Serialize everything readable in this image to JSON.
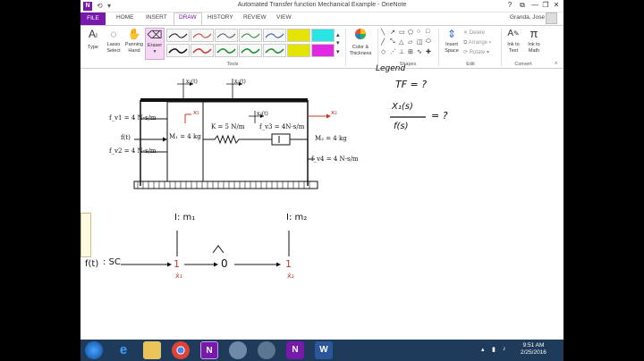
{
  "window": {
    "title": "Automated Transfer function Mechanical Example - OneNote",
    "logo": "N",
    "back_icon": "back-arrow-icon",
    "controls": [
      "?",
      "⧉",
      "—",
      "❐",
      "✕"
    ]
  },
  "tabs": [
    "FILE",
    "HOME",
    "INSERT",
    "DRAW",
    "HISTORY",
    "REVIEW",
    "VIEW"
  ],
  "active_tab": "DRAW",
  "user": {
    "name": "Granda, Jose"
  },
  "ribbon": {
    "type": "Type",
    "lasso": [
      "Lasso",
      "Select"
    ],
    "panning": [
      "Panning",
      "Hand"
    ],
    "eraser": "Eraser",
    "color": [
      "Color &",
      "Thickness"
    ],
    "insert_space": [
      "Insert",
      "Space"
    ],
    "delete": "Delete",
    "arrange": "Arrange",
    "rotate": "Rotate",
    "ink_text": [
      "Ink to",
      "Text"
    ],
    "ink_math": [
      "Ink to",
      "Math"
    ],
    "groups": {
      "tools": "Tools",
      "shapes": "Shapes",
      "edit": "Edit",
      "convert": "Convert"
    },
    "highlighter_colors": [
      "#e4e400",
      "#29e4e4",
      "#e029e0"
    ],
    "pen_colors": [
      "#111111",
      "#c0392b",
      "#1f4fb5",
      "#1a8a2a",
      "#555555"
    ]
  },
  "note": {
    "handwritten_header": "Legend",
    "tf_question": "TF = ?",
    "tf_fraction_num": "X₁(s)",
    "tf_fraction_den": "f(s)",
    "tf_equals": "= ?",
    "x1_label": "x₁(t)",
    "x2_label": "x₂(t)",
    "x1_arrow_label": "x₁",
    "x2_arrow_label": "x₂",
    "x3_label": "x₃(t)",
    "fv1": "f_v1 = 4 N-s/m",
    "f_label": "f(t)",
    "fv2": "f_v2 = 4 N-s/m",
    "m1": "M₁ = 4 kg",
    "k": "K = 5 N/m",
    "fv3": "f_v3 = 4N-s/m",
    "m2": "M₂ = 4 kg",
    "fv4": "f_v4 = 4 N-s/m",
    "node1_label": "I: m₁",
    "node2_label": "I: m₂",
    "force_label": "f(t)",
    "sc_label": ": SC",
    "node1_value": "1",
    "node1_sub": "ẋ₁",
    "node_mid": "0",
    "node3_value": "1",
    "node3_sub": "ẋ₂"
  },
  "taskbar": {
    "time": "9:51 AM",
    "date": "2/25/2016",
    "apps": [
      "start-orb-icon",
      "internet-explorer-icon",
      "file-explorer-icon",
      "chrome-icon",
      "onenote-icon",
      "app-icon",
      "app-icon-2",
      "onenote-icon-2",
      "word-icon"
    ]
  }
}
